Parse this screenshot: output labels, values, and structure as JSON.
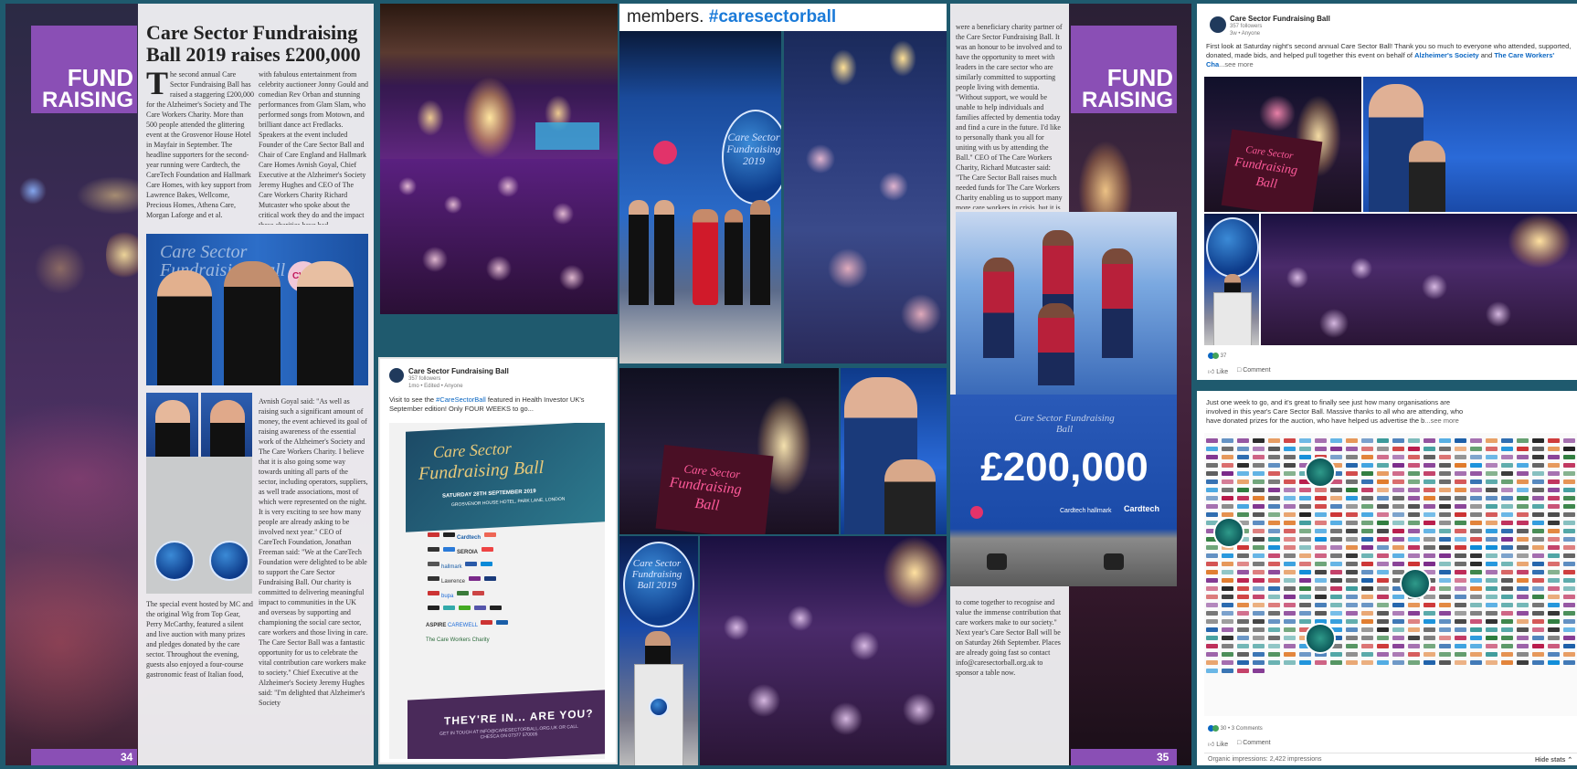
{
  "magazine_left": {
    "banner_line1": "FUND",
    "banner_line2": "RAISING",
    "headline": "Care Sector Fundraising Ball 2019 raises £200,000",
    "col1_dropcap": "T",
    "col1_text": "he second annual Care Sector Fundraising Ball has raised a staggering £200,000 for the Alzheimer's Society and The Care Workers Charity. More than 500 people attended the glittering event at the Grosvenor House Hotel in Mayfair in September. The headline supporters for the second-year running were Cardtech, the CareTech Foundation and Hallmark Care Homes, with key support from Lawrence Bakes, Wellcome, Precious Homes, Athena Care, Morgan Laforge and et al.",
    "col2_text": "with fabulous entertainment from celebrity auctioneer Jonny Gould and comedian Rev Orban and stunning performances from Glam Slam, who performed songs from Motown, and brilliant dance act Fredlacks. Speakers at the event included Founder of the Care Sector Ball and Chair of Care England and Hallmark Care Homes Avnish Goyal, Chief Executive at the Alzheimer's Society Jeremy Hughes and CEO of The Care Workers Charity Richard Mutcaster who spoke about the critical work they do and the impact these charities have had.",
    "col3_text": "Avnish Goyal said: \"As well as raising such a significant amount of money, the event achieved its goal of raising awareness of the essential work of the Alzheimer's Society and The Care Workers Charity. I believe that it is also going some way towards uniting all parts of the sector, including operators, suppliers, as well trade associations, most of which were represented on the night. It is very exciting to see how many people are already asking to be involved next year.\" CEO of CareTech Foundation, Jonathan Freeman said: \"We at the CareTech Foundation were delighted to be able to support the Care Sector Fundraising Ball. Our charity is committed to delivering meaningful impact to communities in the UK and overseas by supporting and championing the social care sector, care workers and those living in care. The Care Sector Ball was a fantastic opportunity for us to celebrate the vital contribution care workers make to society.\" Chief Executive at the Alzheimer's Society Jeremy Hughes said: \"I'm delighted that Alzheimer's Society",
    "col1_bottom_text": "The special event hosted by MC and the original Wig from Top Gear, Perry McCarthy, featured a silent and live auction with many prizes and pledges donated by the care sector. Throughout the evening, guests also enjoyed a four-course gastronomic feast of Italian food,",
    "photo_sign_text": "Care Sector Fundraising Ball",
    "photo_badge": "CWC",
    "page_number": "34"
  },
  "linkedin_post_small": {
    "author": "Care Sector Fundraising Ball",
    "followers": "357 followers",
    "meta": "1mo • Edited • Anyone",
    "body_prefix": "Visit to see the ",
    "hashtag": "#CareSectorBall",
    "body_suffix": " featured in Health Investor UK's September edition! Only FOUR WEEKS to go...",
    "flyer_title_line1": "Care Sector",
    "flyer_title_line2": "Fundraising Ball",
    "flyer_date": "SATURDAY 28TH SEPTEMBER 2019",
    "flyer_venue": "GROSVENOR HOUSE HOTEL, PARK LANE, LONDON",
    "flyer_bottom_headline": "THEY'RE IN... ARE YOU?",
    "flyer_bottom_sub": "GET IN TOUCH AT INFO@CARESECTORBALL.ORG.UK OR CALL CHESCA ON 07377 570005",
    "flyer_logos": [
      "Cardtech",
      "SEROIA",
      "hallmark",
      "Lawrence",
      "bupa",
      "ASPIRE",
      "CAREWELL",
      "The Care Workers Charity"
    ]
  },
  "collage_center": {
    "header_prefix": "members. ",
    "header_hashtag": "#caresectorball",
    "stage_sign_text": "Care Sector Fundraising 2019",
    "sign_line1": "Care Sector",
    "sign_line2": "Fundraising",
    "sign_line3": "Ball",
    "podium_sign_text": "Care Sector Fundraising Ball 2019"
  },
  "magazine_right": {
    "banner_line1": "FUND",
    "banner_line2": "RAISING",
    "col_text_top": "were a beneficiary charity partner of the Care Sector Fundraising Ball. It was an honour to be involved and to have the opportunity to meet with leaders in the care sector who are similarly committed to supporting people living with dementia. \"Without support, we would be unable to help individuals and families affected by dementia today and find a cure in the future. I'd like to personally thank you all for uniting with us by attending the Ball.\" CEO of The Care Workers Charity, Richard Mutcaster said: \"The Care Sector Ball raises much needed funds for The Care Workers Charity enabling us to support many more care workers in crisis, but it is more than just that – it's also an opportunity for the whole care sector",
    "col_text_bottom": "to come together to recognise and value the immense contribution that care workers make to our society.\" Next year's Care Sector Ball will be on Saturday 26th September. Places are already going fast so contact info@caresectorball.org.uk to sponsor a table now.",
    "screen_sign": "Care Sector Fundraising Ball",
    "total_raised": "£200,000",
    "screen_logos": [
      "Cardtech",
      "hallmark",
      "Cardtech"
    ],
    "page_number": "35"
  },
  "linkedin_post_top": {
    "author": "Care Sector Fundraising Ball",
    "followers": "357 followers",
    "meta": "3w • Anyone",
    "body": "First look at Saturday night's second annual Care Sector Ball! Thank you so much to everyone who attended, supported, donated, made bids, and helped pull together this event on behalf of ",
    "link1": "Alzheimer's Society",
    "and": " and ",
    "link2": "The Care Workers' Cha",
    "see_more": "...see more",
    "sign_line1": "Care Sector",
    "sign_line2": "Fundraising",
    "sign_line3": "Ball",
    "reaction_count": "37",
    "like_label": "Like",
    "comment_label": "Comment"
  },
  "linkedin_post_bottom": {
    "body_line1": "Just one week to go, and it's great to finally see just how many organisations are",
    "body_line2": "involved in this year's Care Sector Ball. Massive thanks to all who are attending, who",
    "body_line3": "have donated prizes for the auction, who have helped us advertise the b",
    "see_more": "...see more",
    "reaction_count": "30",
    "comments": "• 3 Comments",
    "like_label": "Like",
    "comment_label": "Comment",
    "impressions": "Organic impressions: 2,422 impressions",
    "hide_stats": "Hide stats"
  },
  "colors": {
    "background": "#1f5a6e",
    "banner_purple": "#8a4fb5",
    "linkedin_blue": "#0a66c2",
    "sign_magenta": "#e23a8a"
  }
}
